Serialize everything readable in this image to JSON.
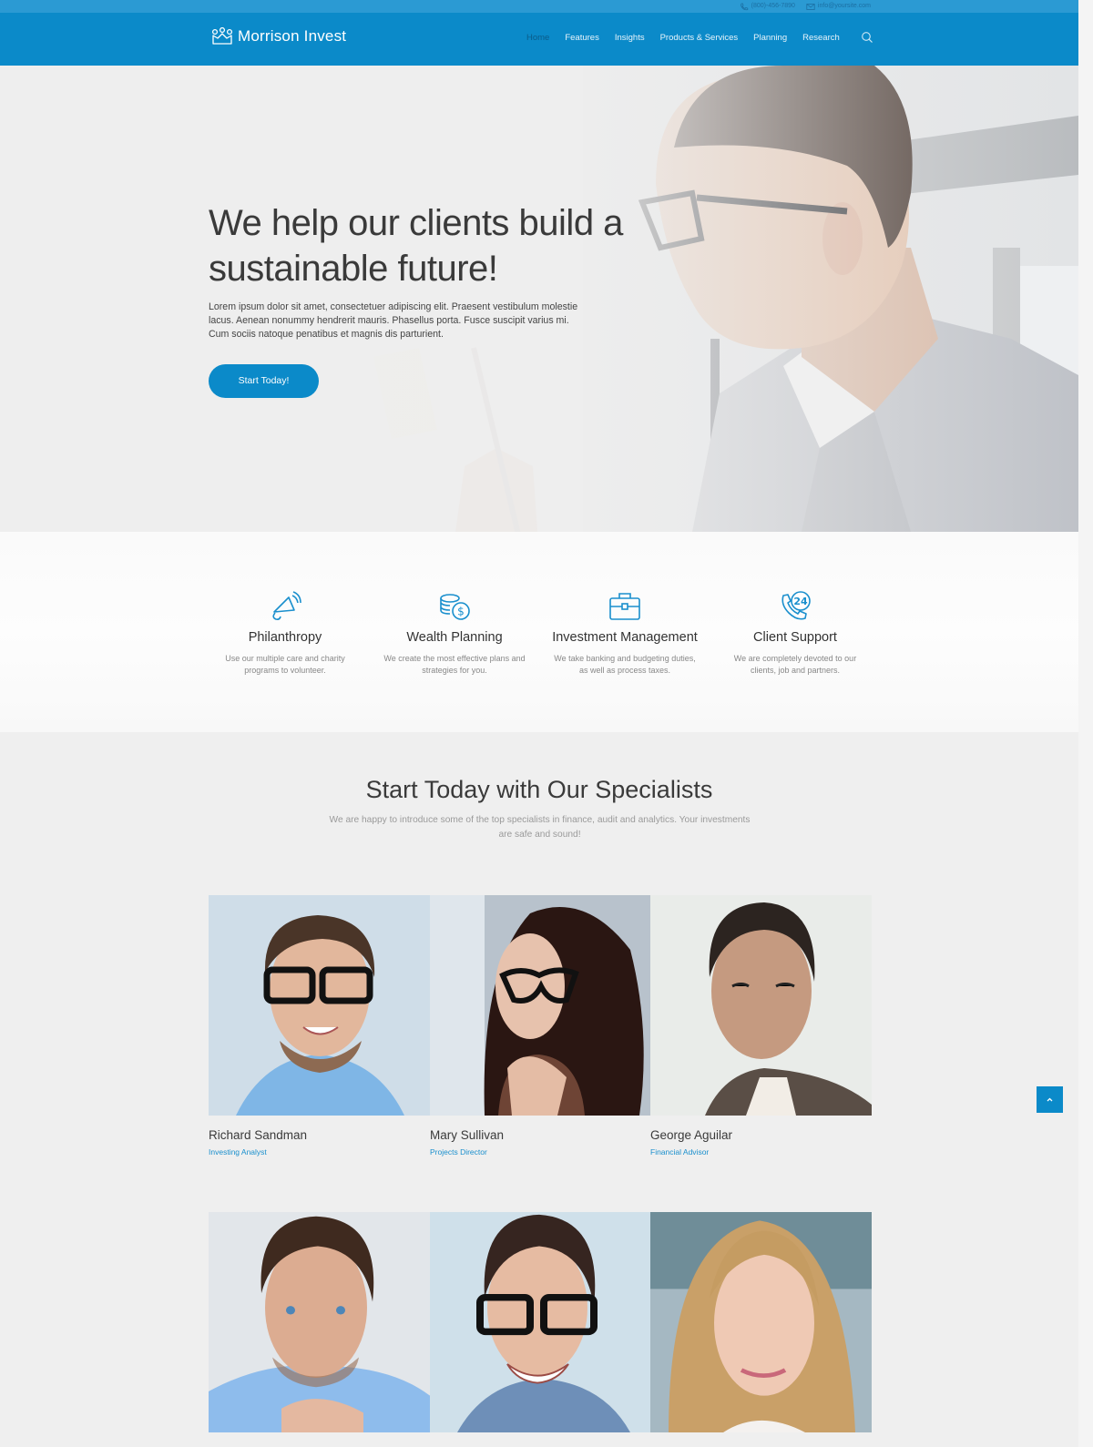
{
  "topbar": {
    "phone": "(800)-456-7890",
    "email": "info@yoursite.com",
    "phone_icon": "phone-icon",
    "email_icon": "envelope-icon"
  },
  "header": {
    "brand": "Morrison Invest",
    "logo_icon": "crown-people-icon",
    "nav": [
      {
        "label": "Home",
        "active": true
      },
      {
        "label": "Features",
        "active": false
      },
      {
        "label": "Insights",
        "active": false
      },
      {
        "label": "Products & Services",
        "active": false
      },
      {
        "label": "Planning",
        "active": false
      },
      {
        "label": "Research",
        "active": false
      }
    ],
    "search_icon": "search-icon"
  },
  "hero": {
    "title": "We help our clients build a sustainable future!",
    "text": "Lorem ipsum dolor sit amet, consectetuer adipiscing elit. Praesent vestibulum molestie lacus. Aenean nonummy hendrerit mauris. Phasellus porta. Fusce suscipit varius mi. Cum sociis natoque penatibus et magnis dis parturient.",
    "button": "Start Today!",
    "image": "man with glasses holding pen"
  },
  "features": [
    {
      "icon": "megaphone-icon",
      "title": "Philanthropy",
      "desc": "Use our multiple care and charity programs to volunteer."
    },
    {
      "icon": "coins-dollar-icon",
      "title": "Wealth Planning",
      "desc": "We create the most effective plans and strategies for you."
    },
    {
      "icon": "briefcase-icon",
      "title": "Investment Management",
      "desc": "We take banking and budgeting duties, as well as process taxes."
    },
    {
      "icon": "phone-24-icon",
      "title": "Client Support",
      "desc": "We are completely devoted to our clients, job and partners."
    }
  ],
  "specialists": {
    "title": "Start Today with Our Specialists",
    "subtitle": "We are happy to introduce some of the top specialists in finance, audit and analytics. Your investments are safe and sound!",
    "people": [
      {
        "name": "Richard Sandman",
        "role": "Investing Analyst"
      },
      {
        "name": "Mary Sullivan",
        "role": "Projects Director"
      },
      {
        "name": "George Aguilar",
        "role": "Financial Advisor"
      },
      {
        "name": "",
        "role": ""
      },
      {
        "name": "",
        "role": ""
      },
      {
        "name": "",
        "role": ""
      }
    ]
  },
  "back_to_top_icon": "chevron-up-icon",
  "colors": {
    "brand": "#0b8ac9",
    "topbar": "#2b9ad3",
    "link": "#1a8fcd",
    "nav_active": "#0b5c8a"
  }
}
